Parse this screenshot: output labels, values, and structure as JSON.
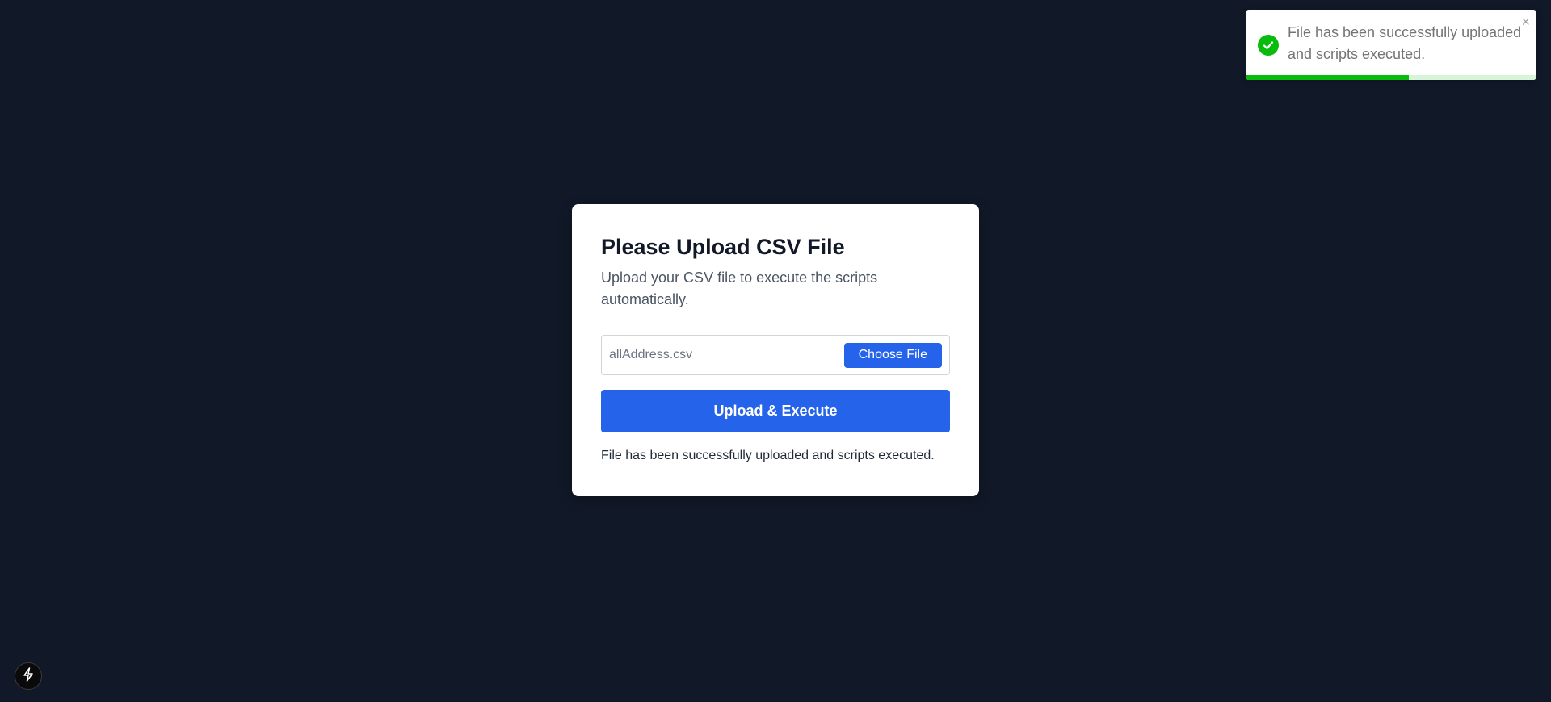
{
  "card": {
    "title": "Please Upload CSV File",
    "subtitle": "Upload your CSV file to execute the scripts automatically.",
    "file_name": "allAddress.csv",
    "choose_file_label": "Choose File",
    "upload_button_label": "Upload & Execute",
    "status_message": "File has been successfully uploaded and scripts executed."
  },
  "toast": {
    "message": "File has been successfully uploaded and scripts executed.",
    "close_symbol": "×",
    "icon": "check-circle-icon",
    "progress_fraction": 0.56,
    "accent_color": "#07bc0c"
  },
  "dev_badge": {
    "icon": "lightning-bolt-icon"
  },
  "colors": {
    "background": "#111827",
    "primary": "#2563eb",
    "card": "#ffffff"
  }
}
